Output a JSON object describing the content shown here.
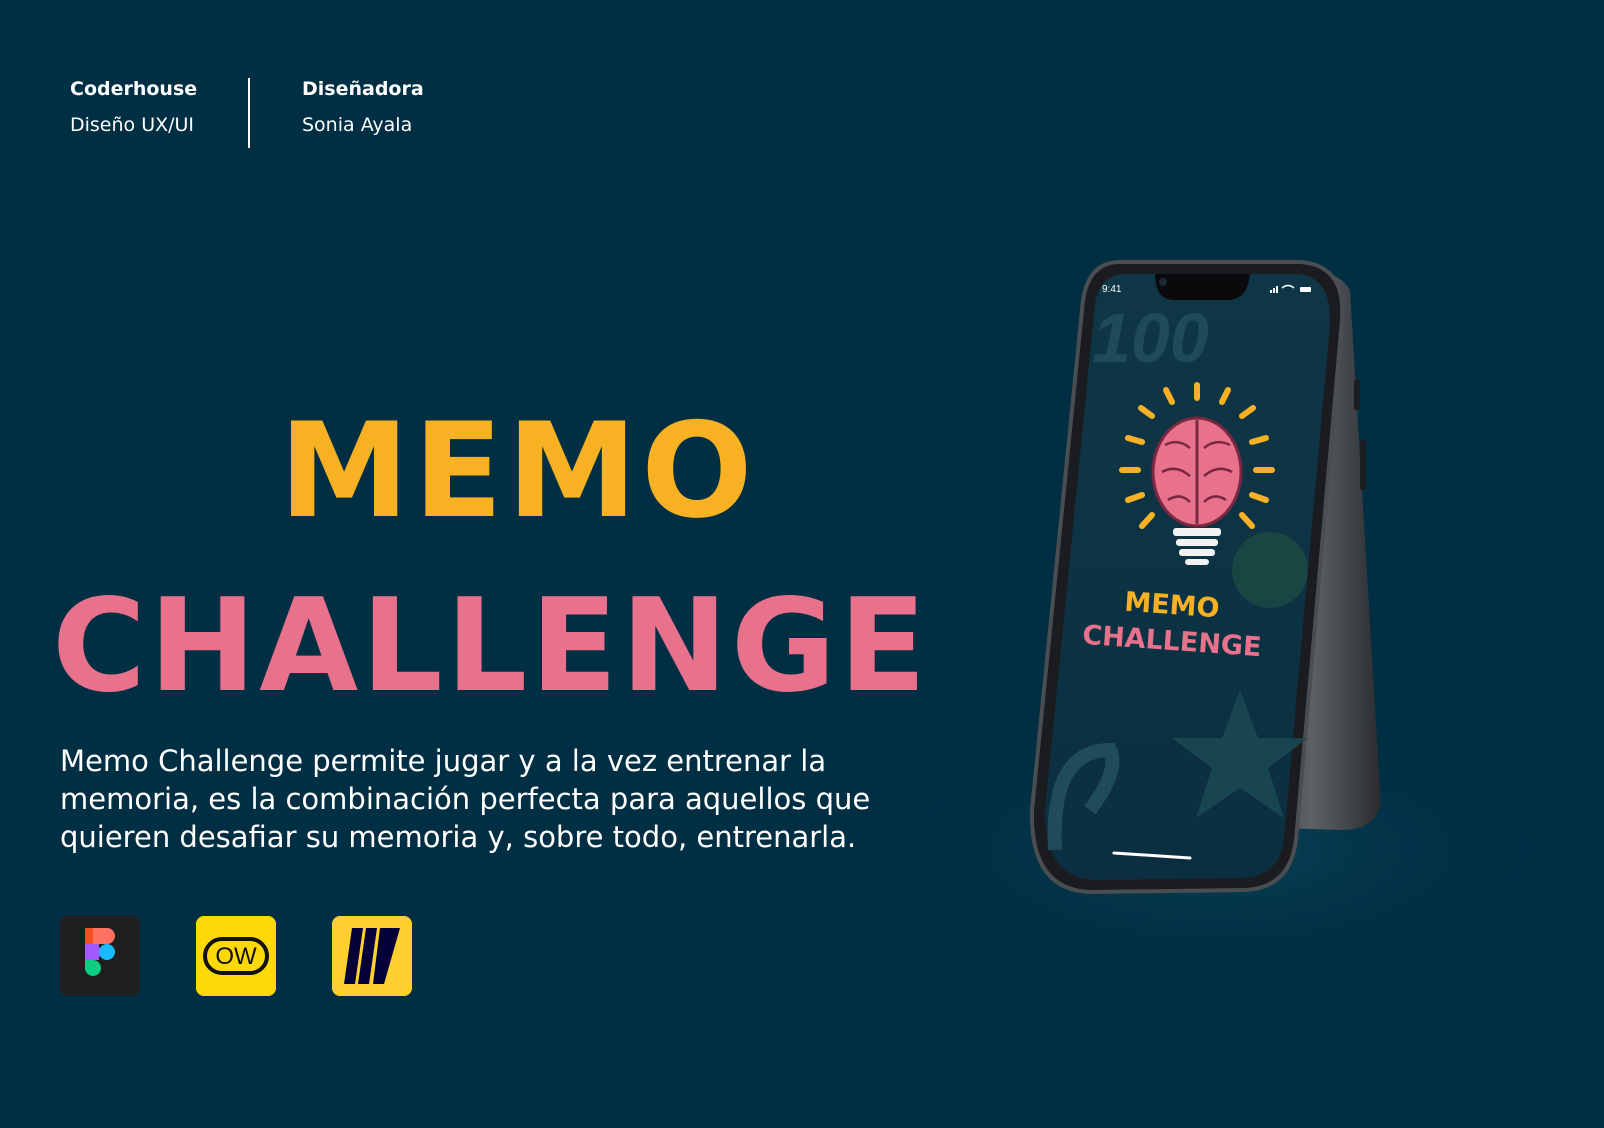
{
  "header": {
    "org_label": "Coderhouse",
    "org_value": "Diseño UX/UI",
    "role_label": "Diseñadora",
    "role_value": "Sonia Ayala"
  },
  "hero": {
    "title_line1": "MEMO",
    "title_line2": "CHALLENGE",
    "description": "Memo Challenge permite jugar y a la vez  entrenar la memoria, es la combinación perfecta para aquellos que quieren desafiar su memoria y, sobre todo, entrenarla."
  },
  "tools": [
    {
      "name": "figma-icon"
    },
    {
      "name": "optimal-workshop-icon",
      "text": "OW"
    },
    {
      "name": "miro-icon"
    }
  ],
  "phone": {
    "status_time": "9:41",
    "screen_title_line1": "MEMO",
    "screen_title_line2": "CHALLENGE",
    "background_number": "100"
  },
  "colors": {
    "background": "#002e43",
    "accent_yellow": "#f8b122",
    "accent_pink": "#e8728c"
  }
}
